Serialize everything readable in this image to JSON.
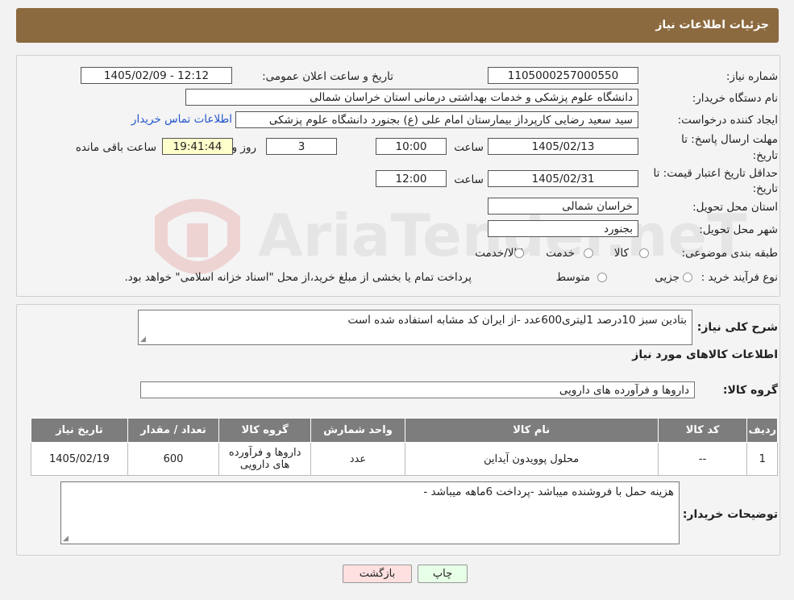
{
  "header": {
    "title": "جزئیات اطلاعات نیاز"
  },
  "fields": {
    "need_number_label": "شماره نیاز:",
    "need_number": "1105000257000550",
    "announce_label": "تاریخ و ساعت اعلان عمومی:",
    "announce_value": "1405/02/09 - 12:12",
    "buyer_label": "نام دستگاه خریدار:",
    "buyer_value": "دانشگاه علوم پزشکی و خدمات بهداشتی درمانی استان خراسان شمالی",
    "creator_label": "ایجاد کننده درخواست:",
    "creator_value": "سید سعید رضایی کارپرداز بیمارستان امام علی (ع) بجنورد دانشگاه علوم پزشکی",
    "contact_link": "اطلاعات تماس خریدار",
    "deadline_label_1": "مهلت ارسال پاسخ: تا",
    "deadline_label_2": "تاریخ:",
    "deadline_date": "1405/02/13",
    "time_label": "ساعت",
    "deadline_time": "10:00",
    "days_value": "3",
    "days_label": "روز و",
    "remaining_time": "19:41:44",
    "remaining_label": "ساعت باقی مانده",
    "validity_label_1": "حداقل تاریخ اعتبار قیمت: تا",
    "validity_label_2": "تاریخ:",
    "validity_date": "1405/02/31",
    "validity_time": "12:00",
    "province_label": "استان محل تحویل:",
    "province_value": "خراسان شمالی",
    "city_label": "شهر محل تحویل:",
    "city_value": "بجنورد",
    "category_label": "طبقه بندی موضوعی:",
    "category_options": [
      "کالا",
      "خدمت",
      "کالا/خدمت"
    ],
    "process_label": "نوع فرآیند خرید :",
    "process_options": [
      "جزیی",
      "متوسط"
    ],
    "process_note": "پرداخت تمام یا بخشی از مبلغ خرید،از محل \"اسناد خزانه اسلامی\" خواهد بود."
  },
  "summary": {
    "label": "شرح کلی نیاز:",
    "value": "بتادین سبز 10درصد 1لیتری600عدد -از ایران کد مشابه استفاده شده است",
    "items_title": "اطلاعات کالاهای مورد نیاز",
    "group_label": "گروه کالا:",
    "group_value": "داروها و فرآورده های دارویی"
  },
  "table": {
    "headers": [
      "ردیف",
      "کد کالا",
      "نام کالا",
      "واحد شمارش",
      "گروه کالا",
      "تعداد / مقدار",
      "تاریخ نیاز"
    ],
    "row": {
      "index": "1",
      "code": "--",
      "name": "محلول پوویدون آیداین",
      "unit": "عدد",
      "group": "داروها و فرآورده های دارویی",
      "qty": "600",
      "date": "1405/02/19"
    }
  },
  "notes": {
    "label": "توضیحات خریدار:",
    "value": "هزینه حمل با فروشنده میباشد -پرداخت 6ماهه میباشد -"
  },
  "buttons": {
    "print": "چاپ",
    "back": "بازگشت"
  },
  "watermark": {
    "text": "AriaTender.neT"
  },
  "colors": {
    "header": "#8c6a3f",
    "print_btn": "#e6ffe6",
    "back_btn": "#ffe0e0"
  }
}
